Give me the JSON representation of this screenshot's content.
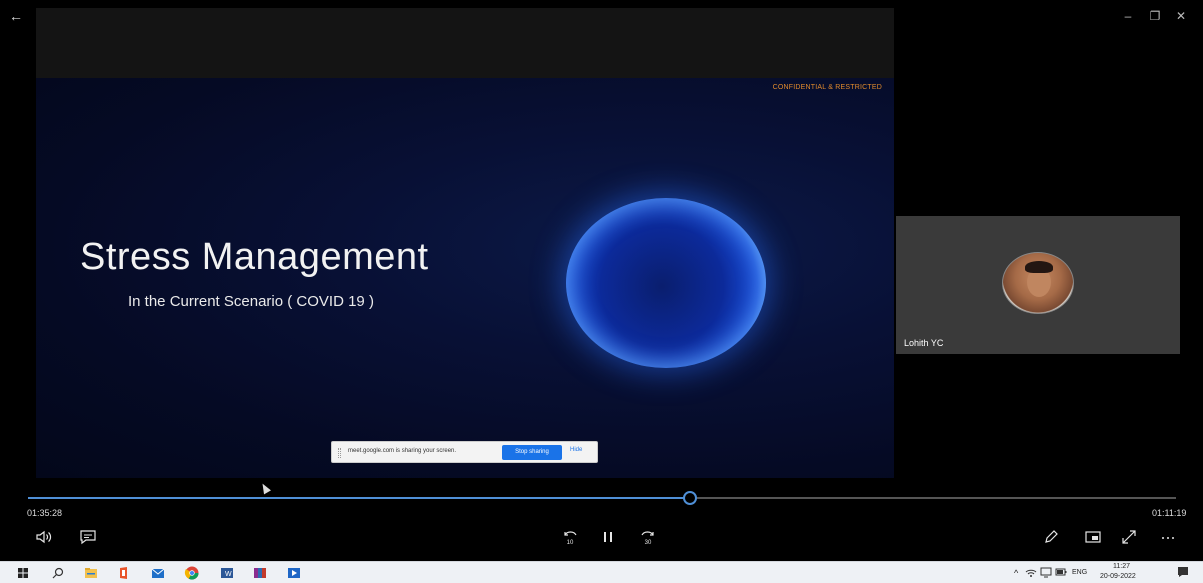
{
  "titlebar": {
    "back_glyph": "←",
    "min_glyph": "–",
    "max_glyph": "❐",
    "close_glyph": "✕"
  },
  "slide": {
    "confidential": "CONFIDENTIAL & RESTRICTED",
    "title": "Stress Management",
    "subtitle": "In the Current Scenario ( COVID 19 )"
  },
  "share_banner": {
    "text": "meet.google.com is sharing your screen.",
    "stop_label": "Stop sharing",
    "hide_label": "Hide"
  },
  "participant": {
    "name": "Lohith YC"
  },
  "player": {
    "elapsed": "01:35:28",
    "remaining": "01:11:19",
    "progress_fraction": 0.577,
    "skip_back_label": "10",
    "skip_forward_label": "30"
  },
  "taskbar": {
    "lang": "ENG",
    "time": "11:27",
    "date": "20-09-2022"
  },
  "colors": {
    "accent": "#4f8fd6",
    "confidential_text": "#e08a2c",
    "google_blue": "#1a73e8"
  }
}
